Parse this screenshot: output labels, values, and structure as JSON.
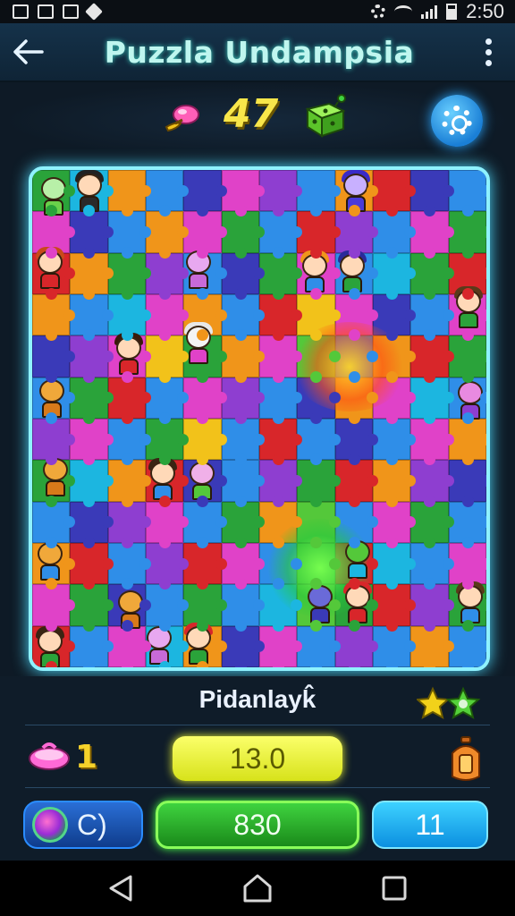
{
  "status_bar": {
    "time": "2:50"
  },
  "header": {
    "title": "Puzzla Undampsia"
  },
  "score": {
    "value": "47"
  },
  "board": {
    "colors": [
      "#2f8ee8",
      "#e042c8",
      "#f0951a",
      "#2aa33a",
      "#3a3ab8",
      "#d8262a",
      "#8e3ed0",
      "#1cb6e0",
      "#f2c21a",
      "#54c83a"
    ],
    "cells": [
      [
        3,
        7,
        2,
        0,
        4,
        1,
        6,
        0,
        2,
        5,
        4,
        0
      ],
      [
        1,
        4,
        0,
        2,
        1,
        3,
        0,
        5,
        6,
        0,
        1,
        3
      ],
      [
        5,
        2,
        3,
        6,
        0,
        4,
        3,
        1,
        0,
        7,
        3,
        5
      ],
      [
        2,
        0,
        7,
        1,
        2,
        0,
        5,
        8,
        1,
        4,
        0,
        1
      ],
      [
        4,
        6,
        1,
        8,
        3,
        2,
        1,
        9,
        0,
        2,
        5,
        3
      ],
      [
        0,
        3,
        5,
        0,
        1,
        6,
        0,
        4,
        2,
        1,
        7,
        0
      ],
      [
        6,
        1,
        0,
        3,
        8,
        0,
        5,
        0,
        4,
        0,
        1,
        2
      ],
      [
        3,
        7,
        2,
        5,
        4,
        0,
        6,
        3,
        5,
        2,
        6,
        4
      ],
      [
        0,
        4,
        6,
        1,
        0,
        3,
        2,
        9,
        0,
        1,
        3,
        0
      ],
      [
        2,
        5,
        0,
        6,
        5,
        1,
        0,
        9,
        5,
        7,
        0,
        1
      ],
      [
        1,
        3,
        4,
        0,
        3,
        0,
        7,
        9,
        3,
        5,
        6,
        3
      ],
      [
        5,
        0,
        1,
        7,
        2,
        4,
        1,
        0,
        6,
        0,
        2,
        0
      ]
    ]
  },
  "status": {
    "label": "Pidanlayk̂"
  },
  "stats": {
    "lives": "1",
    "timer": "13.0",
    "mode_label": "C)",
    "points": "830",
    "level": "11"
  },
  "icons": {
    "candy": "candy-icon",
    "cube": "dice-cube-icon",
    "settings": "gear-icon",
    "stars": "stars-icon",
    "bowl": "bowl-icon",
    "lantern": "lantern-icon"
  }
}
